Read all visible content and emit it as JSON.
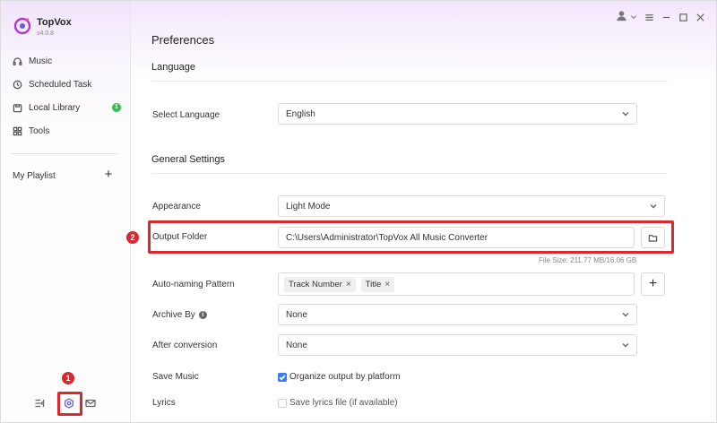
{
  "app": {
    "name": "TopVox",
    "version": "v4.0.8"
  },
  "sidebar": {
    "items": [
      {
        "label": "Music",
        "icon": "headphones-icon"
      },
      {
        "label": "Scheduled Task",
        "icon": "clock-icon"
      },
      {
        "label": "Local Library",
        "icon": "library-icon",
        "badge": "1"
      },
      {
        "label": "Tools",
        "icon": "grid-icon"
      }
    ],
    "playlist_label": "My Playlist",
    "playlist_add": "+"
  },
  "main": {
    "page_title": "Preferences",
    "language_section": "Language",
    "select_language_label": "Select Language",
    "select_language_value": "English",
    "general_section": "General Settings",
    "appearance_label": "Appearance",
    "appearance_value": "Light Mode",
    "output_folder_label": "Output Folder",
    "output_folder_value": "C:\\Users\\Administrator\\TopVox All Music Converter",
    "file_size": "File Size: 211.77 MB/16.06 GB",
    "naming_label": "Auto-naming Pattern",
    "naming_tags": [
      "Track Number",
      "Title"
    ],
    "naming_add": "+",
    "archive_label": "Archive By",
    "archive_value": "None",
    "after_conversion_label": "After conversion",
    "after_conversion_value": "None",
    "save_music_label": "Save Music",
    "save_music_option": "Organize output by platform",
    "save_music_checked": true,
    "lyrics_label": "Lyrics",
    "lyrics_option": "Save lyrics file (if available)",
    "lyrics_checked": false
  },
  "annotations": {
    "step1": "1",
    "step2": "2",
    "color": "#d9282f"
  },
  "colors": {
    "accent": "#3b7cf2",
    "badge": "#2fbf4a",
    "settings_icon": "#6b5bd6"
  }
}
